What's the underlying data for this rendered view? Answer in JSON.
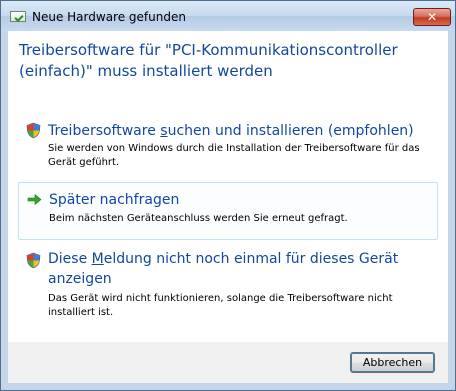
{
  "window": {
    "title": "Neue Hardware gefunden",
    "close_label": "✕"
  },
  "heading": "Treibersoftware für \"PCI-Kommunikationscontroller (einfach)\" muss installiert werden",
  "options": [
    {
      "title_pre": "Treibersoftware ",
      "title_accel": "s",
      "title_post": "uchen und installieren (empfohlen)",
      "description": "Sie werden von Windows durch die Installation der Treibersoftware für das Gerät geführt.",
      "icon": "shield-icon"
    },
    {
      "title_pre": "Später nachfragen",
      "title_accel": "",
      "title_post": "",
      "description": "Beim nächsten Geräteanschluss werden Sie erneut gefragt.",
      "icon": "green-arrow-icon"
    },
    {
      "title_pre": "Diese ",
      "title_accel": "M",
      "title_post": "eldung nicht noch einmal für dieses Gerät anzeigen",
      "description": "Das Gerät wird nicht funktionieren, solange die Treibersoftware nicht installiert ist.",
      "icon": "shield-icon"
    }
  ],
  "footer": {
    "cancel_label": "Abbrechen"
  },
  "colors": {
    "heading": "#13479c",
    "hover_border": "#bfe3f1",
    "close": "#c23b22"
  }
}
